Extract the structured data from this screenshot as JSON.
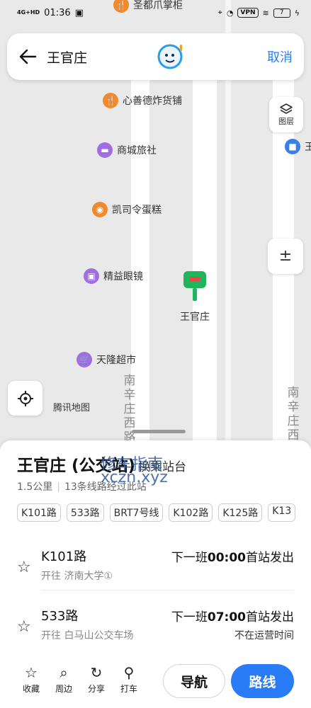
{
  "status_bar": {
    "network": "4G+HD",
    "time": "01:36",
    "vpn": "VPN",
    "battery": "7"
  },
  "search": {
    "query": "王官庄",
    "cancel": "取消"
  },
  "map": {
    "top_poi": "圣都爪掌柜",
    "pois": [
      {
        "name": "心善德炸货铺",
        "icon": "fork-knife-icon",
        "color": "#f08a2c"
      },
      {
        "name": "商城旅社",
        "icon": "bed-icon",
        "color": "#a06ee0"
      },
      {
        "name": "凯司令蛋糕",
        "icon": "cake-icon",
        "color": "#f08a2c"
      },
      {
        "name": "精益眼镜",
        "icon": "shopping-bag-icon",
        "color": "#a06ee0"
      },
      {
        "name": "天隆超市",
        "icon": "cart-icon",
        "color": "#a06ee0"
      }
    ],
    "station_marker_label": "王官庄",
    "right_edge_label": "王",
    "road_left": "南辛庄西路",
    "road_right": "南辛庄西",
    "layers_label": "图层",
    "provider": "腾讯地图"
  },
  "station": {
    "name": "王官庄 (公交站)",
    "tag": "换乘站台",
    "distance": "1.5公里",
    "lines_info": "13条线路经过此站",
    "routes": [
      "K101路",
      "533路",
      "BRT7号线",
      "K102路",
      "K125路",
      "K13"
    ],
    "details": [
      {
        "name": "K101路",
        "direction": "开往 济南大学①",
        "next_prefix": "下一班",
        "next_time": "00:00",
        "next_suffix": "首站发出",
        "status": ""
      },
      {
        "name": "533路",
        "direction": "开往 白马山公交车场",
        "next_prefix": "下一班",
        "next_time": "07:00",
        "next_suffix": "首站发出",
        "status": "不在运营时间"
      }
    ]
  },
  "toolbar": {
    "items": [
      {
        "label": "收藏",
        "icon": "star-icon"
      },
      {
        "label": "周边",
        "icon": "search-icon"
      },
      {
        "label": "分享",
        "icon": "share-icon"
      },
      {
        "label": "打车",
        "icon": "taxi-icon"
      }
    ],
    "navigate": "导航",
    "route": "路线"
  },
  "watermark": {
    "line1": "修车指南",
    "line2": "xczn.xyz"
  },
  "colors": {
    "accent": "#2a7cf6",
    "marker": "#1fb55c"
  }
}
